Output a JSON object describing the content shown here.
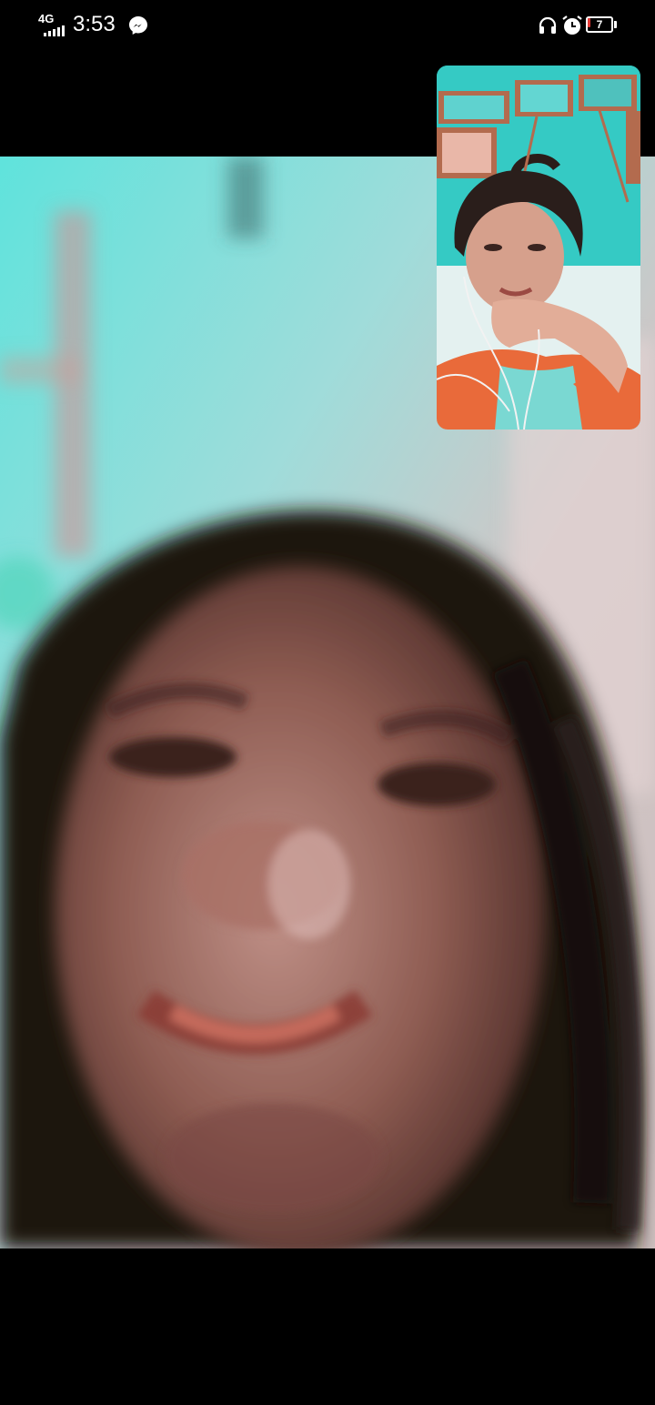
{
  "status_bar": {
    "network": "4G",
    "time": "3:53",
    "battery_level": "7",
    "icons": [
      "signal-icon",
      "messenger-icon",
      "headphones-icon",
      "alarm-icon",
      "battery-icon"
    ]
  },
  "call": {
    "remote_video": "remote-participant-video",
    "self_preview": "self-camera-preview"
  },
  "colors": {
    "background": "#000000",
    "battery_low": "#e53935",
    "video_tint": "#33c9c4"
  }
}
